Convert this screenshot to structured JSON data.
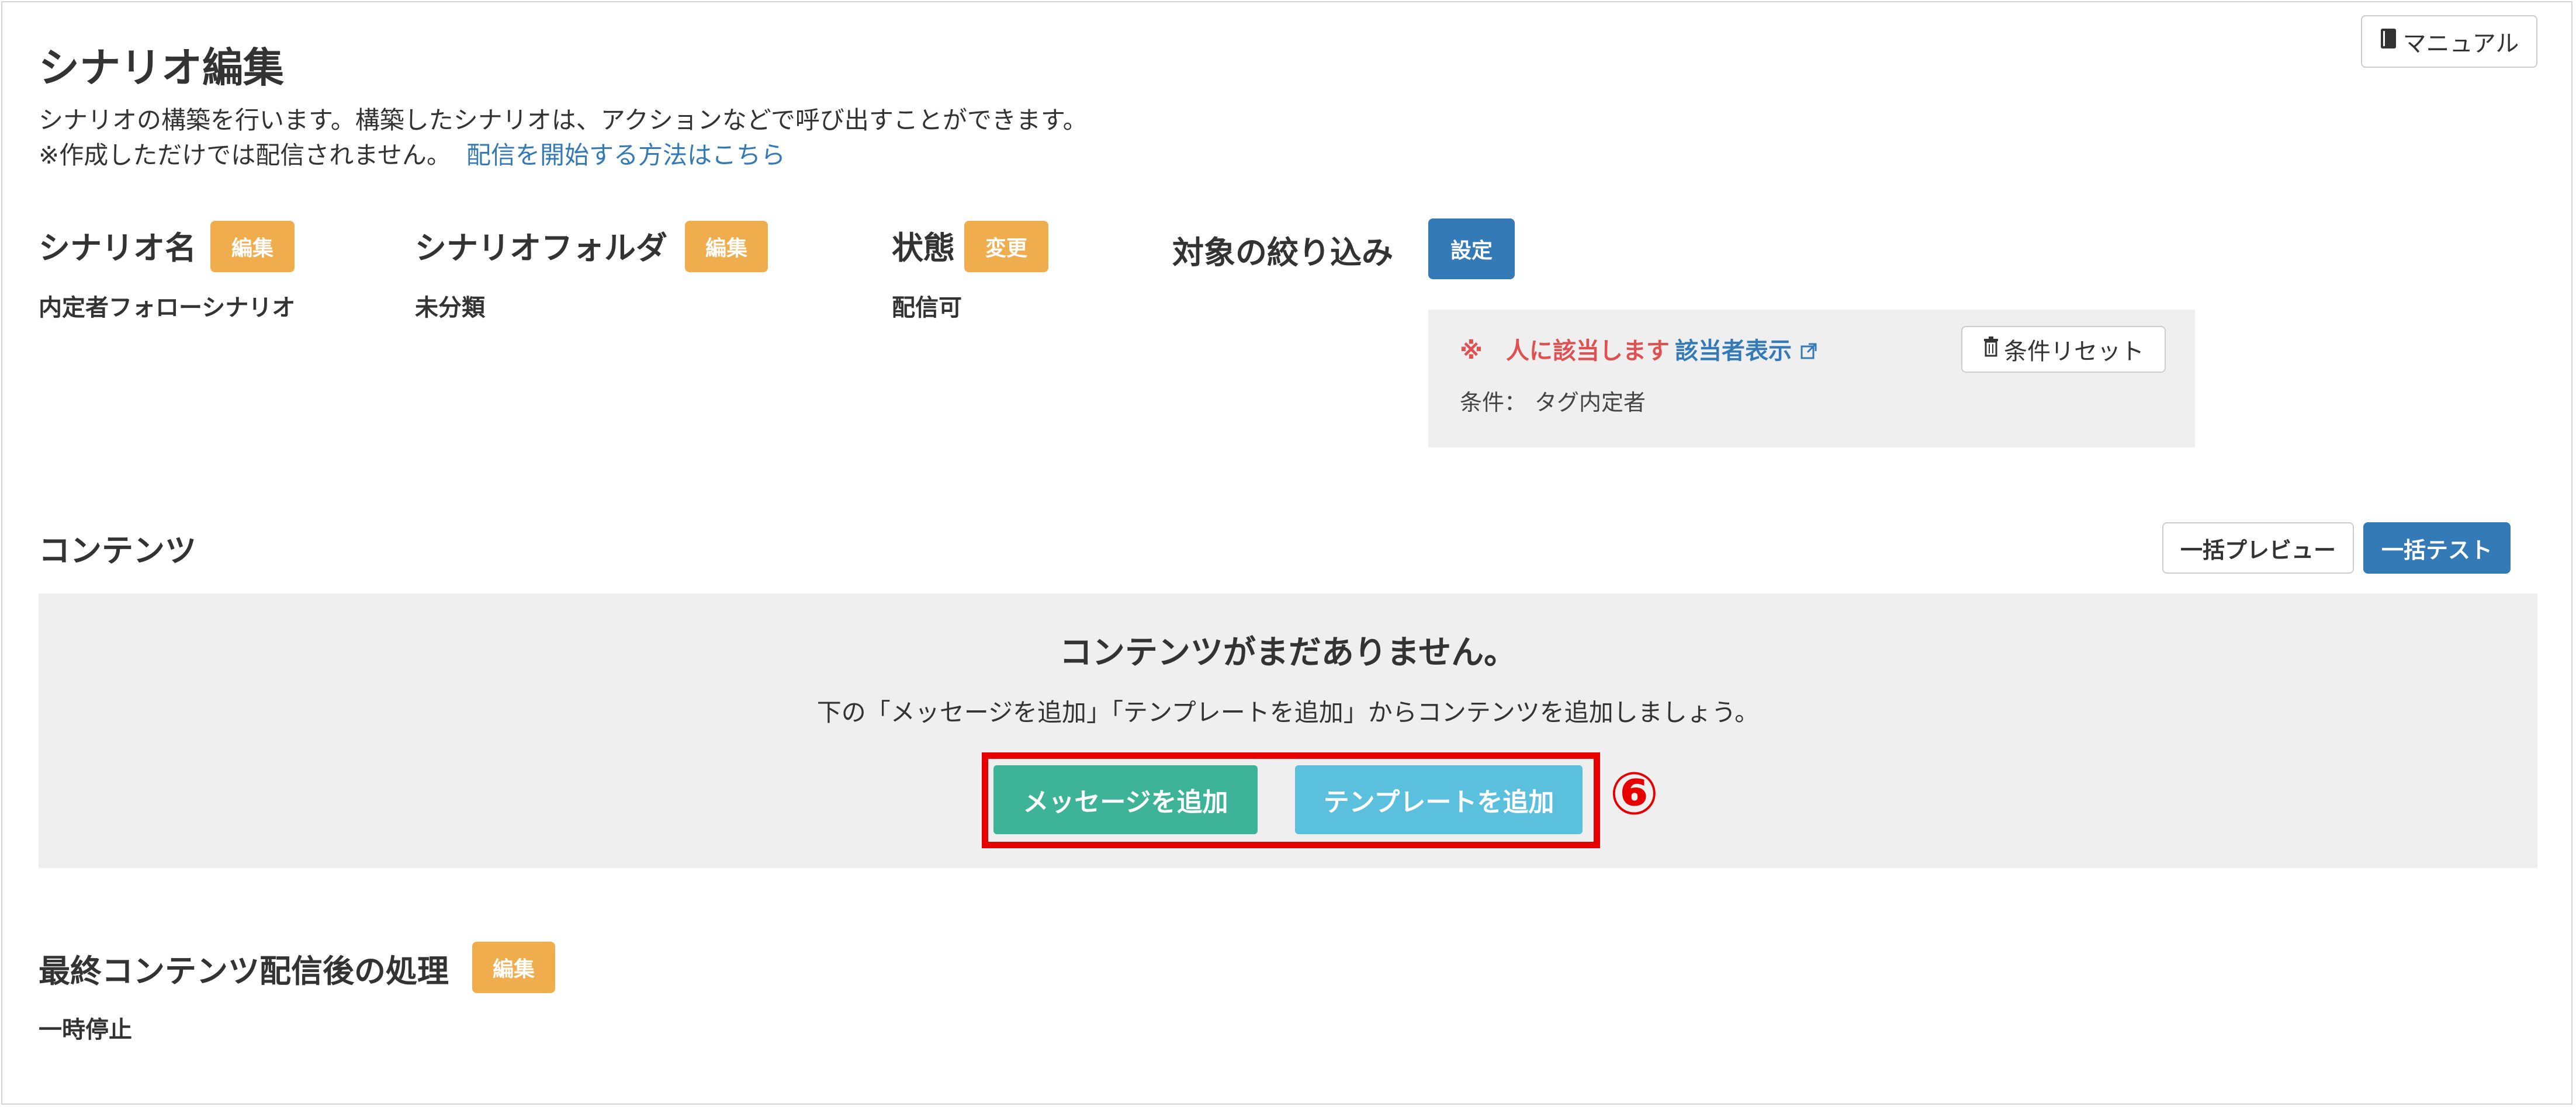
{
  "colors": {
    "accent_blue": "#337ab7",
    "badge_orange": "#f0ad4e",
    "warning_red": "#e05050",
    "add_message_green": "#3db497",
    "add_template_cyan": "#5bc0de",
    "annotation_red": "#e60000"
  },
  "header": {
    "manual_icon": "book-icon",
    "manual_label": "マニュアル",
    "title": "シナリオ編集",
    "description_line1": "シナリオの構築を行います。構築したシナリオは、アクションなどで呼び出すことができます。",
    "description_line2": "※作成しただけでは配信されません。",
    "howto_link": "配信を開始する方法はこちら"
  },
  "fields": {
    "scenario_name": {
      "label": "シナリオ名",
      "badge": "編集",
      "value": "内定者フォローシナリオ"
    },
    "scenario_folder": {
      "label": "シナリオフォルダ",
      "badge": "編集",
      "value": "未分類"
    },
    "status": {
      "label": "状態",
      "badge": "変更",
      "value": "配信可"
    },
    "targeting": {
      "label": "対象の絞り込み",
      "button": "設定"
    }
  },
  "filter_panel": {
    "match_text": "※　人に該当します",
    "show_matches_link": "該当者表示",
    "show_matches_icon": "external-link-icon",
    "reset_icon": "trash-icon",
    "reset_label": "条件リセット",
    "condition_label": "条件：",
    "condition_value": "タグ内定者"
  },
  "contents": {
    "heading": "コンテンツ",
    "bulk_preview": "一括プレビュー",
    "bulk_test": "一括テスト",
    "empty_title": "コンテンツがまだありません。",
    "empty_hint": "下の「メッセージを追加」「テンプレートを追加」からコンテンツを追加しましょう。",
    "add_message": "メッセージを追加",
    "add_template": "テンプレートを追加",
    "annotation_number": "⑥"
  },
  "final_processing": {
    "label": "最終コンテンツ配信後の処理",
    "badge": "編集",
    "value": "一時停止"
  }
}
